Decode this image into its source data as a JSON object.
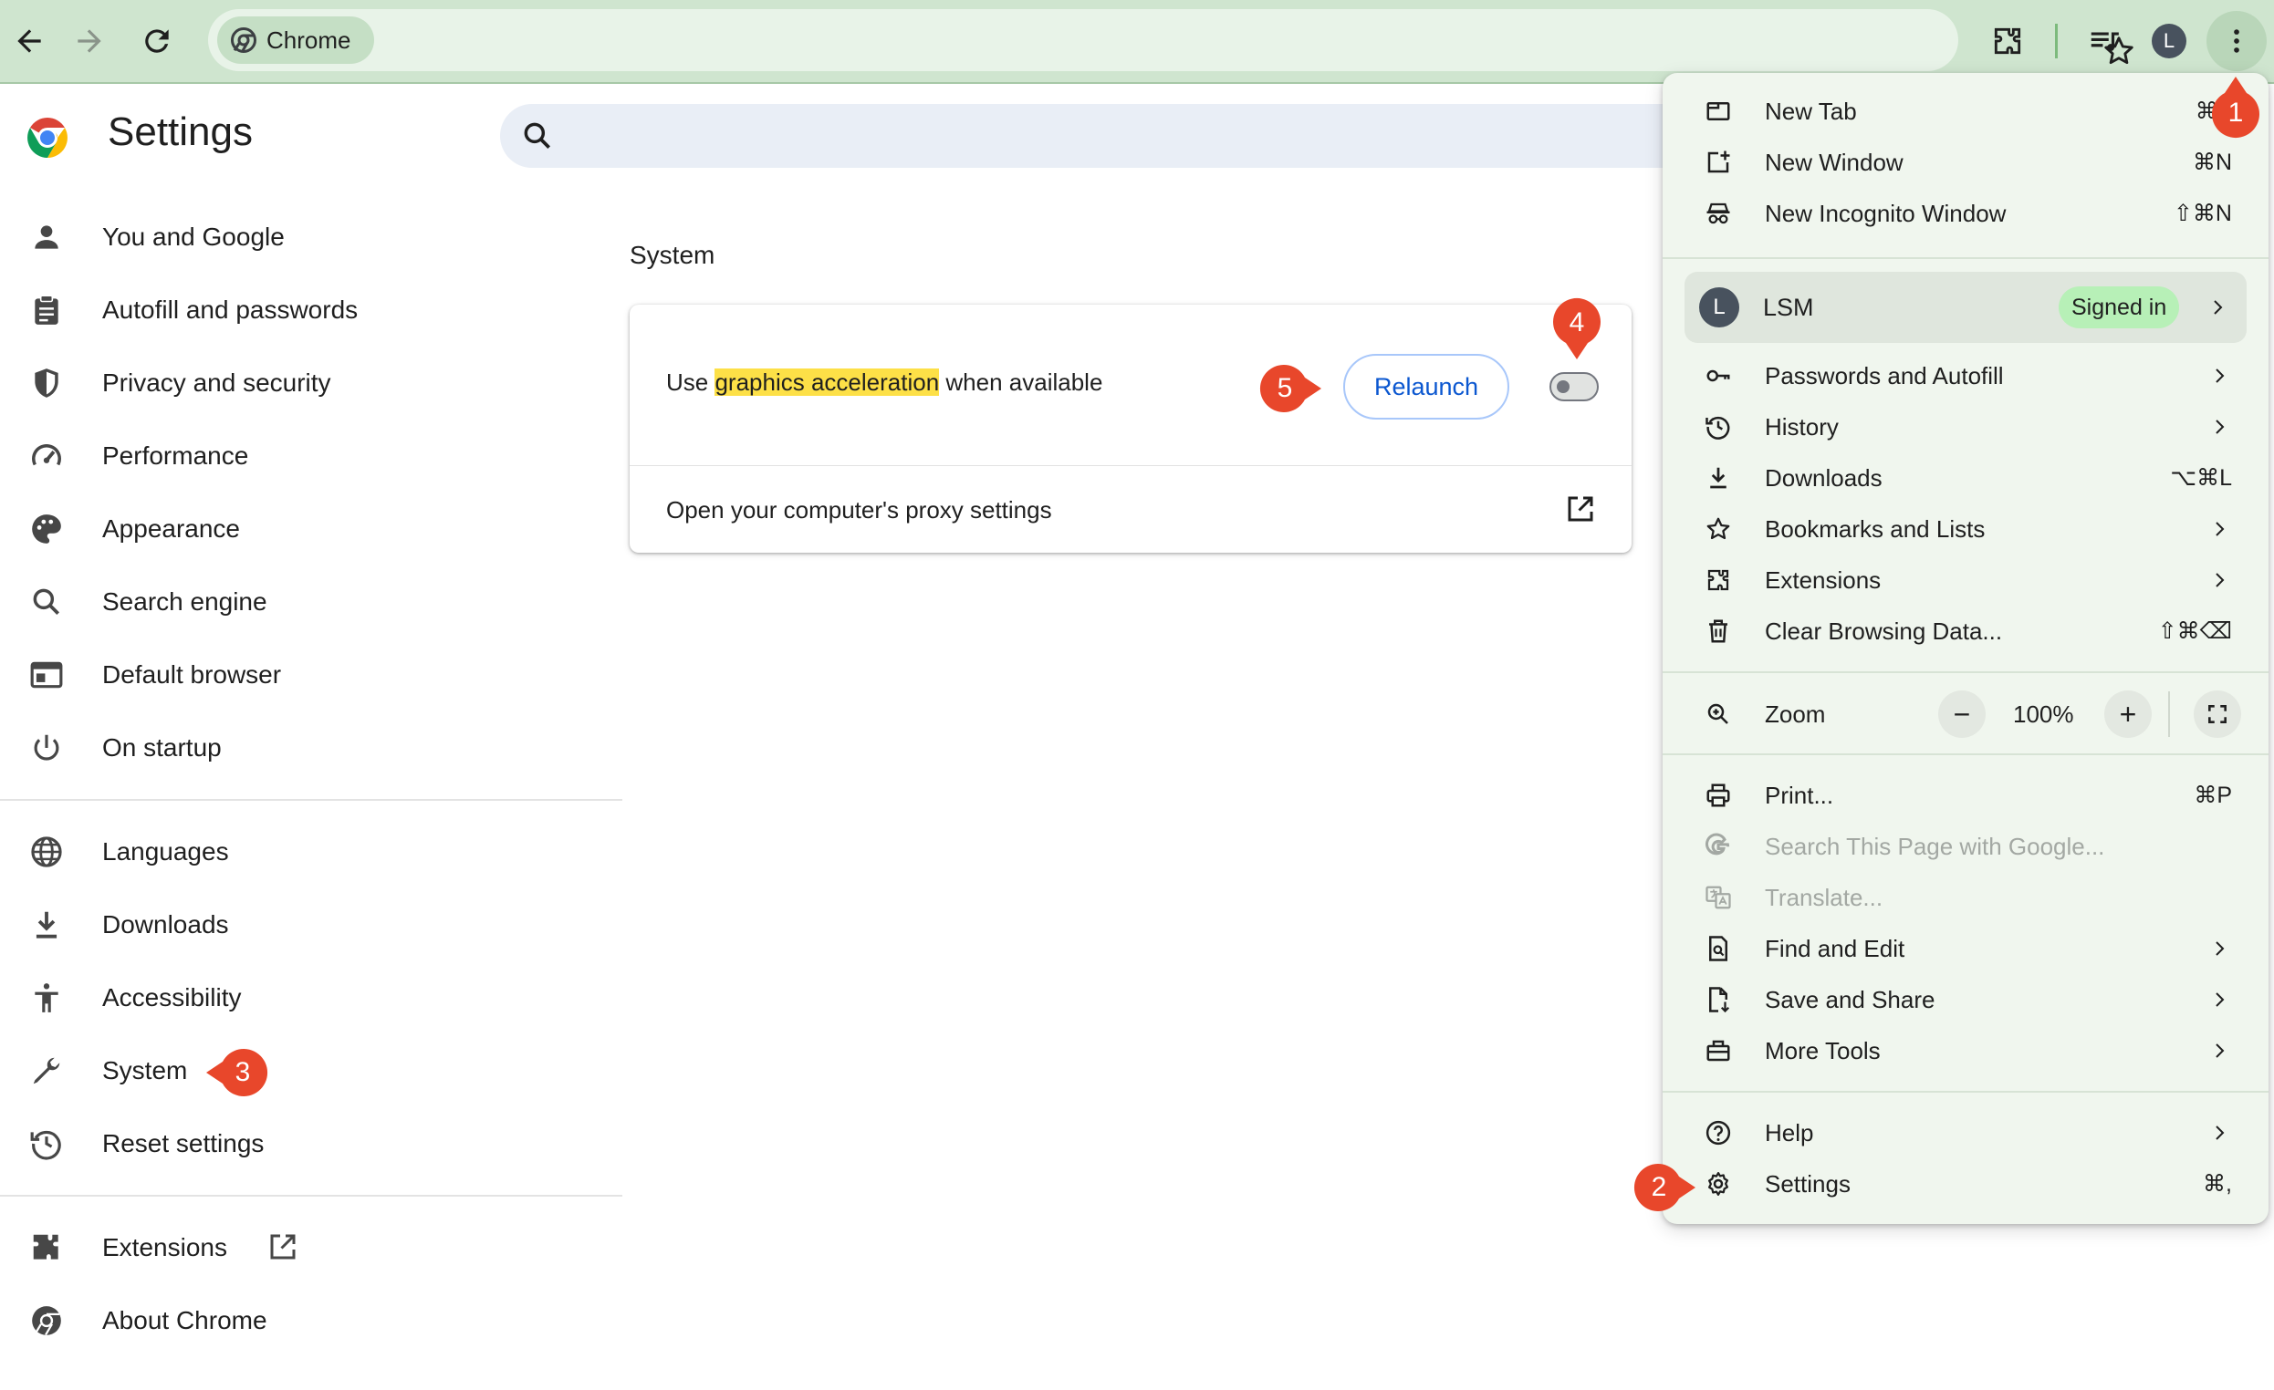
{
  "browser": {
    "tab_chip_label": "Chrome",
    "avatar_letter": "L",
    "icons": [
      "back-icon",
      "forward-icon",
      "reload-icon",
      "chrome-icon",
      "star-icon",
      "extensions-icon",
      "media-icon",
      "kebab-menu-icon"
    ],
    "accent_color": "#cfe5cf"
  },
  "settings": {
    "title": "Settings",
    "nav": [
      {
        "label": "You and Google",
        "icon": "person-icon"
      },
      {
        "label": "Autofill and passwords",
        "icon": "clipboard-icon"
      },
      {
        "label": "Privacy and security",
        "icon": "shield-icon"
      },
      {
        "label": "Performance",
        "icon": "speedometer-icon"
      },
      {
        "label": "Appearance",
        "icon": "palette-icon"
      },
      {
        "label": "Search engine",
        "icon": "search-icon"
      },
      {
        "label": "Default browser",
        "icon": "browser-window-icon"
      },
      {
        "label": "On startup",
        "icon": "power-icon"
      },
      {
        "label": "Languages",
        "icon": "globe-icon"
      },
      {
        "label": "Downloads",
        "icon": "download-icon"
      },
      {
        "label": "Accessibility",
        "icon": "accessibility-icon"
      },
      {
        "label": "System",
        "icon": "wrench-icon"
      },
      {
        "label": "Reset settings",
        "icon": "history-icon"
      },
      {
        "label": "Extensions",
        "icon": "puzzle-icon"
      },
      {
        "label": "About Chrome",
        "icon": "chrome-icon"
      }
    ],
    "section_title": "System",
    "graphics_row": {
      "prefix": "Use ",
      "highlight": "graphics acceleration",
      "suffix": " when available"
    },
    "relaunch_label": "Relaunch",
    "toggle_on": false,
    "proxy_label": "Open your computer's proxy settings"
  },
  "menu": {
    "new_tab": {
      "label": "New Tab",
      "shortcut": "⌘T"
    },
    "new_window": {
      "label": "New Window",
      "shortcut": "⌘N"
    },
    "incognito": {
      "label": "New Incognito Window",
      "shortcut": "⇧⌘N"
    },
    "profile": {
      "avatar": "L",
      "name": "LSM",
      "status": "Signed in"
    },
    "passwords": {
      "label": "Passwords and Autofill"
    },
    "history": {
      "label": "History"
    },
    "downloads": {
      "label": "Downloads",
      "shortcut": "⌥⌘L"
    },
    "bookmarks": {
      "label": "Bookmarks and Lists"
    },
    "extensions": {
      "label": "Extensions"
    },
    "clear": {
      "label": "Clear Browsing Data...",
      "shortcut": "⇧⌘⌫"
    },
    "zoom": {
      "label": "Zoom",
      "minus": "−",
      "value": "100%",
      "plus": "+"
    },
    "print": {
      "label": "Print...",
      "shortcut": "⌘P"
    },
    "search_google": {
      "label": "Search This Page with Google..."
    },
    "translate": {
      "label": "Translate..."
    },
    "find_edit": {
      "label": "Find and Edit"
    },
    "save_share": {
      "label": "Save and Share"
    },
    "more_tools": {
      "label": "More Tools"
    },
    "help": {
      "label": "Help"
    },
    "settings": {
      "label": "Settings",
      "shortcut": "⌘,"
    }
  },
  "annotations": [
    {
      "number": "1"
    },
    {
      "number": "2"
    },
    {
      "number": "3"
    },
    {
      "number": "4"
    },
    {
      "number": "5"
    }
  ],
  "marker_color": "#e8472b"
}
